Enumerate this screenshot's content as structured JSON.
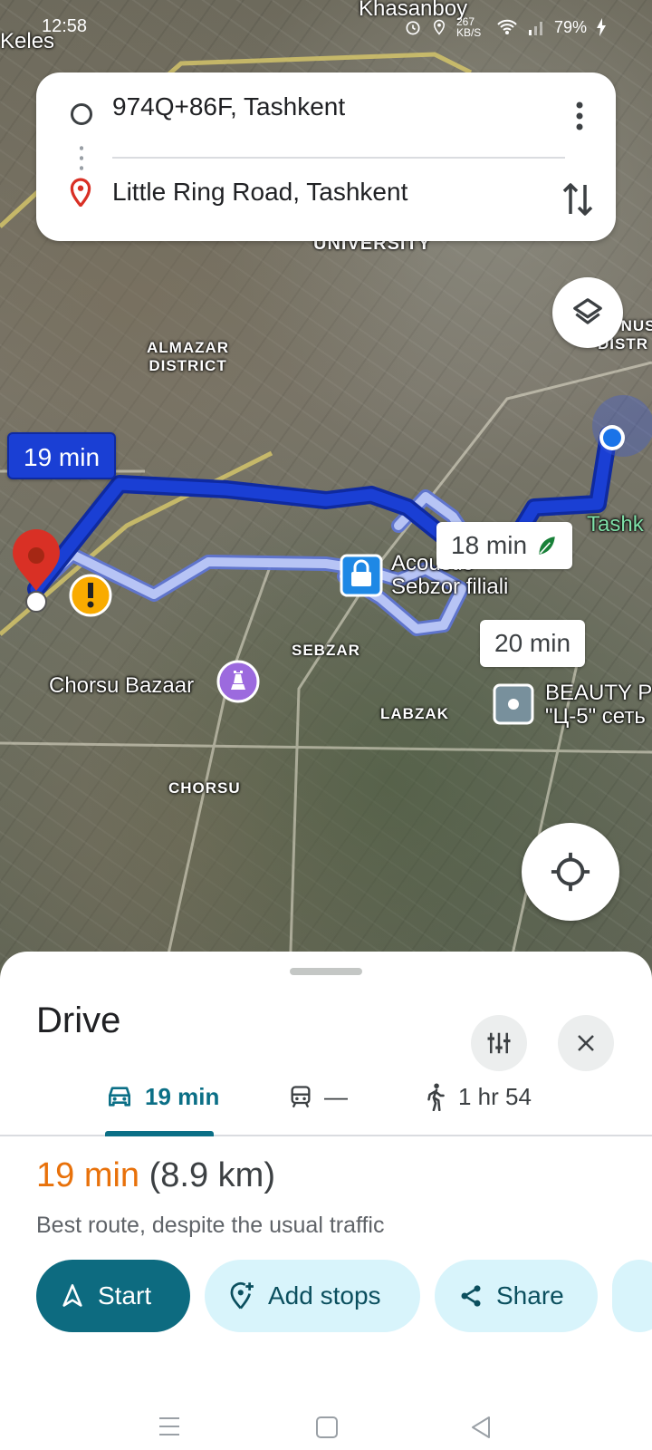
{
  "status_bar": {
    "time": "12:58",
    "speed": "267 KB/S",
    "battery": "79%"
  },
  "search": {
    "origin": "974Q+86F, Tashkent",
    "destination": "Little Ring Road, Tashkent"
  },
  "map": {
    "labels": {
      "top_place": "Khasanboy",
      "keles": "Keles",
      "university": "UNIVERSITY",
      "almazar": "ALMAZAR\nDISTRICT",
      "sebzar": "SEBZAR",
      "labzak": "LABZAK",
      "chorsu": "CHORSU",
      "tashk": "Tashk",
      "yunus": "YUNUS\nDISTR"
    },
    "pois": {
      "chorsu_bazaar": "Chorsu Bazaar",
      "acoustic": "Acoustic\nSebzor filiali",
      "beauty": "BEAUTY P\n\"Ц-5\" сеть"
    },
    "routes": {
      "main_time": "19 min",
      "alt_eco_time": "18 min",
      "alt_time": "20 min"
    }
  },
  "sheet": {
    "title": "Drive",
    "modes": [
      {
        "icon": "car-icon",
        "label": "19 min",
        "active": true
      },
      {
        "icon": "transit-icon",
        "label": "—",
        "active": false
      },
      {
        "icon": "walk-icon",
        "label": "1 hr 54",
        "active": false
      }
    ],
    "summary_time": "19 min",
    "summary_distance": "(8.9 km)",
    "summary_note": "Best route, despite the usual traffic",
    "actions": {
      "start": "Start",
      "add_stops": "Add stops",
      "share": "Share"
    }
  },
  "colors": {
    "route_main": "#1a3fd4",
    "route_alt": "#a9b8f2",
    "accent": "#0d6b80",
    "time_orange": "#e8710a"
  }
}
